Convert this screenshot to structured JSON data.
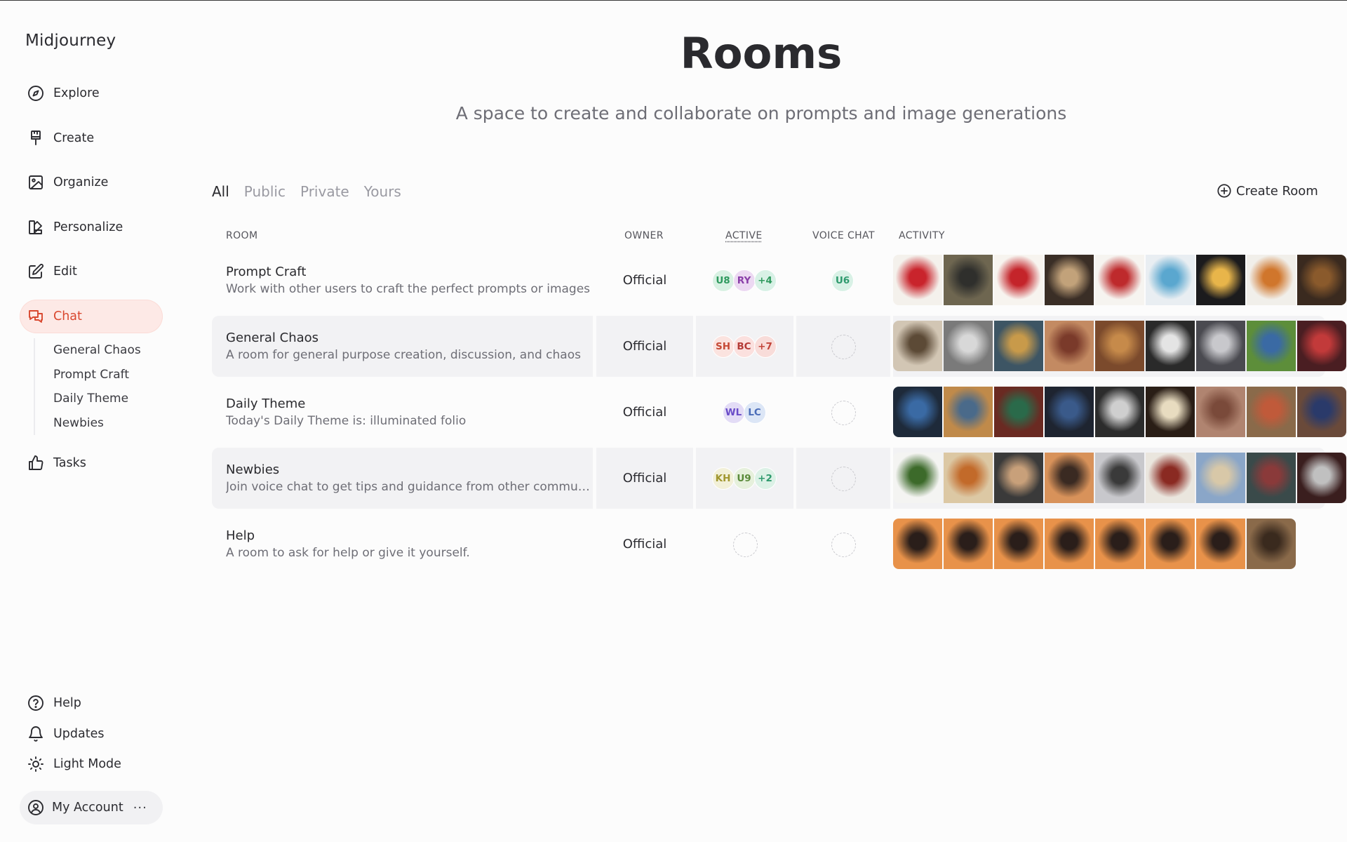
{
  "app": {
    "brand": "Midjourney"
  },
  "nav": [
    {
      "label": "Explore",
      "icon": "compass-icon"
    },
    {
      "label": "Create",
      "icon": "brush-icon"
    },
    {
      "label": "Organize",
      "icon": "image-icon"
    },
    {
      "label": "Personalize",
      "icon": "palette-icon"
    },
    {
      "label": "Edit",
      "icon": "edit-icon"
    },
    {
      "label": "Chat",
      "icon": "chat-icon",
      "active": true
    }
  ],
  "subnav": [
    "General Chaos",
    "Prompt Craft",
    "Daily Theme",
    "Newbies"
  ],
  "tasks": {
    "label": "Tasks",
    "icon": "thumbs-up-icon"
  },
  "footer": [
    {
      "label": "Help",
      "icon": "help-icon"
    },
    {
      "label": "Updates",
      "icon": "bell-icon"
    },
    {
      "label": "Light Mode",
      "icon": "sun-icon"
    }
  ],
  "account": {
    "label": "My Account",
    "more": "···"
  },
  "header": {
    "title": "Rooms",
    "subtitle": "A space to create and collaborate on prompts and image generations"
  },
  "filters": {
    "all": "All",
    "public": "Public",
    "private": "Private",
    "yours": "Yours",
    "active": "All"
  },
  "create_room": "Create Room",
  "columns": {
    "room": "ROOM",
    "owner": "OWNER",
    "active": "ACTIVE",
    "voice": "VOICE CHAT",
    "activity": "ACTIVITY"
  },
  "rooms": [
    {
      "name": "Prompt Craft",
      "desc": "Work with other users to craft the perfect prompts or images",
      "owner": "Official",
      "active": [
        {
          "text": "U8",
          "bg": "#d9f1e3",
          "fg": "#2f9a5e"
        },
        {
          "text": "RY",
          "bg": "#ecd9f2",
          "fg": "#8a3fa8"
        },
        {
          "text": "+4",
          "bg": "#d8f1e6",
          "fg": "#2f9a5e"
        }
      ],
      "voice": [
        {
          "text": "U6",
          "bg": "#d9f1e6",
          "fg": "#2f9a6e"
        }
      ],
      "activity_colors": [
        "#f4f1ec|#c9242c",
        "#6e6650|#2f2f2c",
        "#f7f4ef|#c4242a",
        "#3a2e26|#c2a27a",
        "#f6f4f0|#be2a2c",
        "#e9eef2|#5aa7cf",
        "#1b1b1d|#e8b54a",
        "#f1efea|#d0762c",
        "#3a2a1f|#8a5a2c"
      ]
    },
    {
      "name": "General Chaos",
      "desc": "A room for general purpose creation, discussion, and chaos",
      "owner": "Official",
      "active": [
        {
          "text": "SH",
          "bg": "#fbe3df",
          "fg": "#c64a36"
        },
        {
          "text": "BC",
          "bg": "#fbe0de",
          "fg": "#b43a36"
        },
        {
          "text": "+7",
          "bg": "#f8dcd9",
          "fg": "#c2453a"
        }
      ],
      "voice": [],
      "activity_colors": [
        "#d2c6b4|#5c4a36",
        "#7a7a7a|#d8d8d8",
        "#3d5564|#c89a4a",
        "#c38a62|#7a3a2a",
        "#7b4a2c|#c68a4a",
        "#2a2a2a|#e4e4e4",
        "#4a4a50|#c8c8cc",
        "#5d8e3a|#3a6aa4",
        "#4a1e22|#c23a3a"
      ]
    },
    {
      "name": "Daily Theme",
      "desc": "Today's Daily Theme is: illuminated folio",
      "owner": "Official",
      "active": [
        {
          "text": "WL",
          "bg": "#e3dcf6",
          "fg": "#6a4cc8"
        },
        {
          "text": "LC",
          "bg": "#dce6f6",
          "fg": "#4a6cb8"
        }
      ],
      "voice": [],
      "activity_colors": [
        "#1e2a3a|#3a6aa4",
        "#c08a4a|#4a6a8a",
        "#6a2a22|#2a6a4a",
        "#1e2430|#3a5a8a",
        "#2c2c2c|#cfcfcf",
        "#2a1e16|#e8dcc0",
        "#b08470|#7a4a3a",
        "#8a6a4a|#c05a3a",
        "#6a4a3a|#2a3a6a"
      ]
    },
    {
      "name": "Newbies",
      "desc": "Join voice chat to get tips and guidance from other commun...",
      "owner": "Official",
      "active": [
        {
          "text": "KH",
          "bg": "#f2f0d8",
          "fg": "#a0962e"
        },
        {
          "text": "U9",
          "bg": "#e6f0dc",
          "fg": "#5a8a3a"
        },
        {
          "text": "+2",
          "bg": "#dcf1e6",
          "fg": "#2f9a6e"
        }
      ],
      "voice": [],
      "activity_colors": [
        "#f4f4f2|#3c6a2a",
        "#dcc8a4|#c26a2a",
        "#3a3a3a|#c8a07a",
        "#d8925a|#3a2a22",
        "#c8c8cc|#3a3a3a",
        "#eae6de|#8a2a22",
        "#8aa6c8|#d8c8a8",
        "#3a4a4a|#8a3a3a",
        "#3a1e1e|#c0c0c0"
      ]
    },
    {
      "name": "Help",
      "desc": "A room to ask for help or give it yourself.",
      "owner": "Official",
      "active": [],
      "voice": [],
      "activity_colors": [
        "#e8924a|#2a1e1a",
        "#e8924a|#2a1e1a",
        "#e8924a|#2a1e1a",
        "#e8924a|#2a1e1a",
        "#e8924a|#2a1e1a",
        "#e8924a|#2a1e1a",
        "#e8924a|#2a1e1a",
        "#8a6a4a|#3a2a1e"
      ]
    }
  ]
}
